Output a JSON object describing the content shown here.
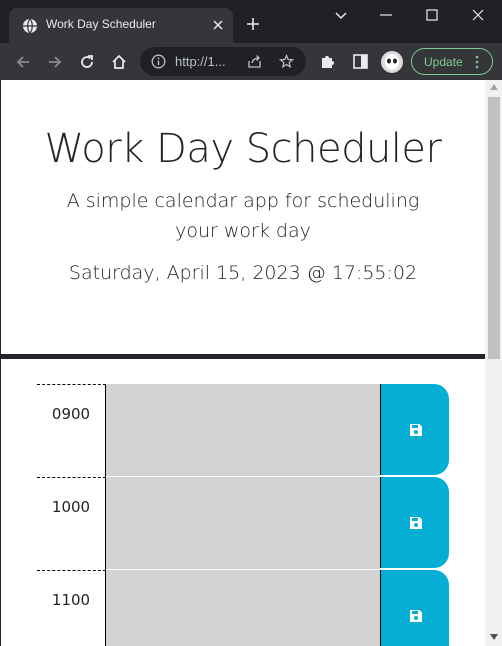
{
  "browser": {
    "tab_title": "Work Day Scheduler",
    "url_text": "http://1...",
    "update_label": "Update"
  },
  "page": {
    "title": "Work Day Scheduler",
    "lead": "A simple calendar app for scheduling your work day",
    "current_datetime": "Saturday, April 15, 2023 @ 17:55:02"
  },
  "schedule": {
    "rows": [
      {
        "hour": "0900",
        "description": ""
      },
      {
        "hour": "1000",
        "description": ""
      },
      {
        "hour": "1100",
        "description": ""
      }
    ]
  },
  "colors": {
    "past_block": "#d3d3d3",
    "save_button": "#06aed5",
    "divider": "#212529",
    "update_accent": "#81c995"
  },
  "icons": {
    "save": "floppy-disk-icon"
  }
}
